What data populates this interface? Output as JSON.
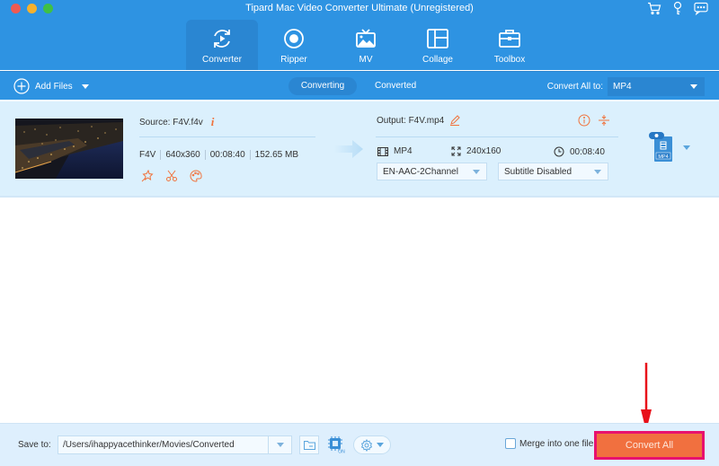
{
  "window": {
    "title": "Tipard Mac Video Converter Ultimate (Unregistered)",
    "top_icons": [
      "cart-icon",
      "key-icon",
      "feedback-icon"
    ]
  },
  "nav": {
    "items": [
      {
        "label": "Converter",
        "icon": "converter-icon",
        "active": true
      },
      {
        "label": "Ripper",
        "icon": "ripper-icon",
        "active": false
      },
      {
        "label": "MV",
        "icon": "mv-icon",
        "active": false
      },
      {
        "label": "Collage",
        "icon": "collage-icon",
        "active": false
      },
      {
        "label": "Toolbox",
        "icon": "toolbox-icon",
        "active": false
      }
    ]
  },
  "toolbar": {
    "add_files_label": "Add Files",
    "tabs": [
      {
        "label": "Converting",
        "active": true
      },
      {
        "label": "Converted",
        "active": false
      }
    ],
    "convert_all_to_label": "Convert All to:",
    "convert_all_to_value": "MP4"
  },
  "file": {
    "source_label": "Source: F4V.f4v",
    "source_info_icon": "i",
    "format": "F4V",
    "resolution": "640x360",
    "duration": "00:08:40",
    "size": "152.65 MB",
    "edit_actions": [
      "enhance-icon",
      "cut-icon",
      "palette-icon"
    ],
    "output_label": "Output: F4V.mp4",
    "output_format": "MP4",
    "output_resolution": "240x160",
    "output_duration": "00:08:40",
    "audio_track": "EN-AAC-2Channel",
    "subtitle": "Subtitle Disabled",
    "format_badge": "MP4"
  },
  "bottom": {
    "save_to_label": "Save to:",
    "save_path": "/Users/ihappyacethinker/Movies/Converted",
    "hw_accel_badge": "ON",
    "merge_label": "Merge into one file",
    "merge_checked": false,
    "convert_all_label": "Convert All"
  },
  "colors": {
    "header_bg": "#2e93e2",
    "accent_orange": "#f1703f",
    "highlight_border": "#e8116e",
    "annotation_arrow": "#e8101a"
  }
}
